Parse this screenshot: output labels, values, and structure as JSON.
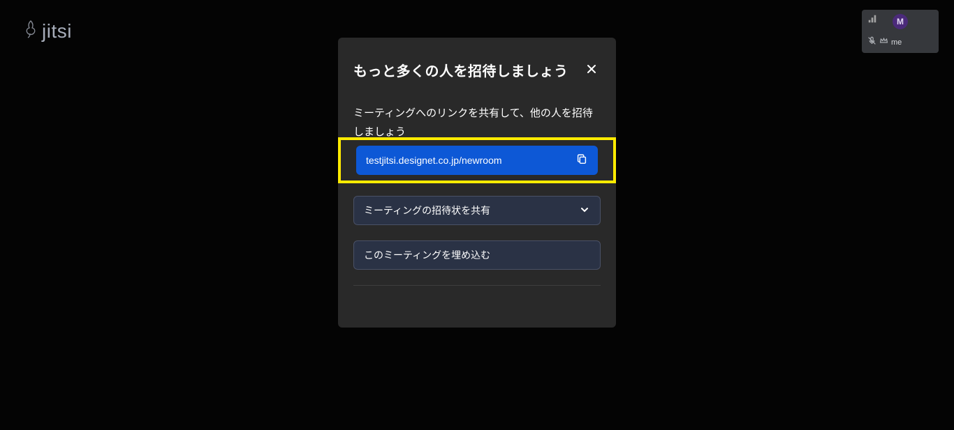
{
  "app": {
    "name": "jitsi"
  },
  "participant": {
    "avatar_initial": "M",
    "display_name": "me"
  },
  "modal": {
    "title": "もっと多くの人を招待しましょう",
    "description": "ミーティングへのリンクを共有して、他の人を招待しましょう",
    "meeting_link": "testjitsi.designet.co.jp/newroom",
    "share_invite_label": "ミーティングの招待状を共有",
    "embed_label": "このミーティングを埋め込む"
  }
}
